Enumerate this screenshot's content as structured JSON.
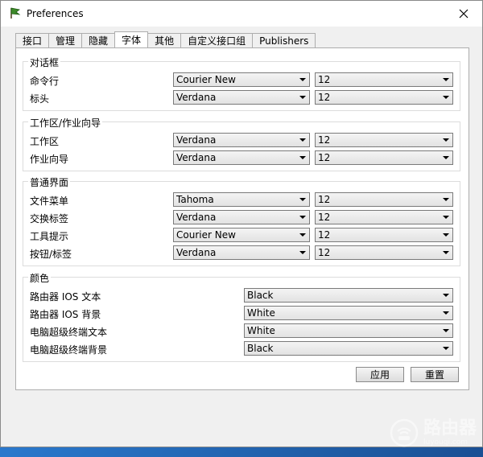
{
  "window": {
    "title": "Preferences"
  },
  "tabs": [
    {
      "label": "接口",
      "active": false
    },
    {
      "label": "管理",
      "active": false
    },
    {
      "label": "隐藏",
      "active": false
    },
    {
      "label": "字体",
      "active": true
    },
    {
      "label": "其他",
      "active": false
    },
    {
      "label": "自定义接口组",
      "active": false
    },
    {
      "label": "Publishers",
      "active": false
    }
  ],
  "groups": {
    "dialog": {
      "title": "对话框",
      "rows": [
        {
          "label": "命令行",
          "font": "Courier New",
          "size": "12"
        },
        {
          "label": "标头",
          "font": "Verdana",
          "size": "12"
        }
      ]
    },
    "workspace": {
      "title": "工作区/作业向导",
      "rows": [
        {
          "label": "工作区",
          "font": "Verdana",
          "size": "12"
        },
        {
          "label": "作业向导",
          "font": "Verdana",
          "size": "12"
        }
      ]
    },
    "general": {
      "title": "普通界面",
      "rows": [
        {
          "label": "文件菜单",
          "font": "Tahoma",
          "size": "12"
        },
        {
          "label": "交换标签",
          "font": "Verdana",
          "size": "12"
        },
        {
          "label": "工具提示",
          "font": "Courier New",
          "size": "12"
        },
        {
          "label": "按钮/标签",
          "font": "Verdana",
          "size": "12"
        }
      ]
    },
    "colors": {
      "title": "颜色",
      "rows": [
        {
          "label": "路由器 IOS 文本",
          "value": "Black"
        },
        {
          "label": "路由器 IOS 背景",
          "value": "White"
        },
        {
          "label": "电脑超级终端文本",
          "value": "White"
        },
        {
          "label": "电脑超级终端背景",
          "value": "Black"
        }
      ]
    }
  },
  "buttons": {
    "apply": "应用",
    "reset": "重置"
  },
  "watermark": {
    "main": "路由器",
    "sub": "luyouqi.com"
  }
}
